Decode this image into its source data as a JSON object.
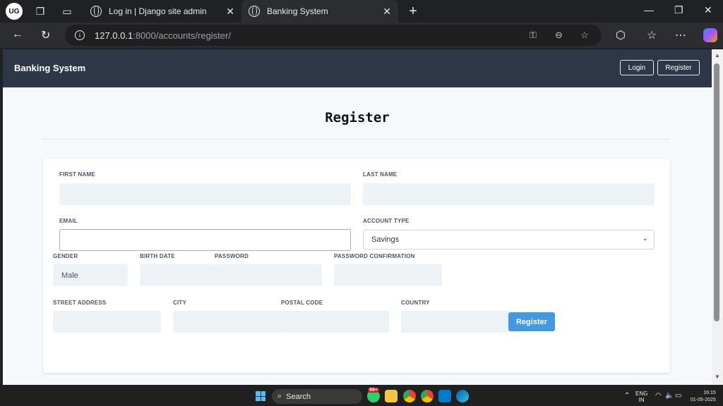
{
  "browser": {
    "profile_initials": "UG",
    "tabs": [
      {
        "title": "Log in | Django site admin",
        "active": false
      },
      {
        "title": "Banking System",
        "active": true
      }
    ],
    "url_host": "127.0.0.1",
    "url_rest": ":8000/accounts/register/"
  },
  "app": {
    "brand": "Banking System",
    "login_label": "Login",
    "register_label": "Register"
  },
  "form": {
    "title": "Register",
    "first_name_label": "FIRST NAME",
    "last_name_label": "LAST NAME",
    "email_label": "EMAIL",
    "account_type_label": "ACCOUNT TYPE",
    "account_type_value": "Savings",
    "gender_label": "GENDER",
    "gender_value": "Male",
    "birth_date_label": "BIRTH DATE",
    "password_label": "PASSWORD",
    "password_confirmation_label": "PASSWORD CONFIRMATION",
    "street_address_label": "STREET ADDRESS",
    "city_label": "CITY",
    "postal_code_label": "POSTAL CODE",
    "country_label": "COUNTRY",
    "submit_label": "Register"
  },
  "taskbar": {
    "search_label": "Search",
    "notification_count": "99+",
    "lang": "ENG",
    "region": "IN",
    "time": "16:15",
    "date": "01-05-2025"
  },
  "colors": {
    "header_bg": "#2d3748",
    "page_bg": "#f5f9fc",
    "input_bg": "#edf2f7",
    "submit_bg": "#4299e1"
  }
}
